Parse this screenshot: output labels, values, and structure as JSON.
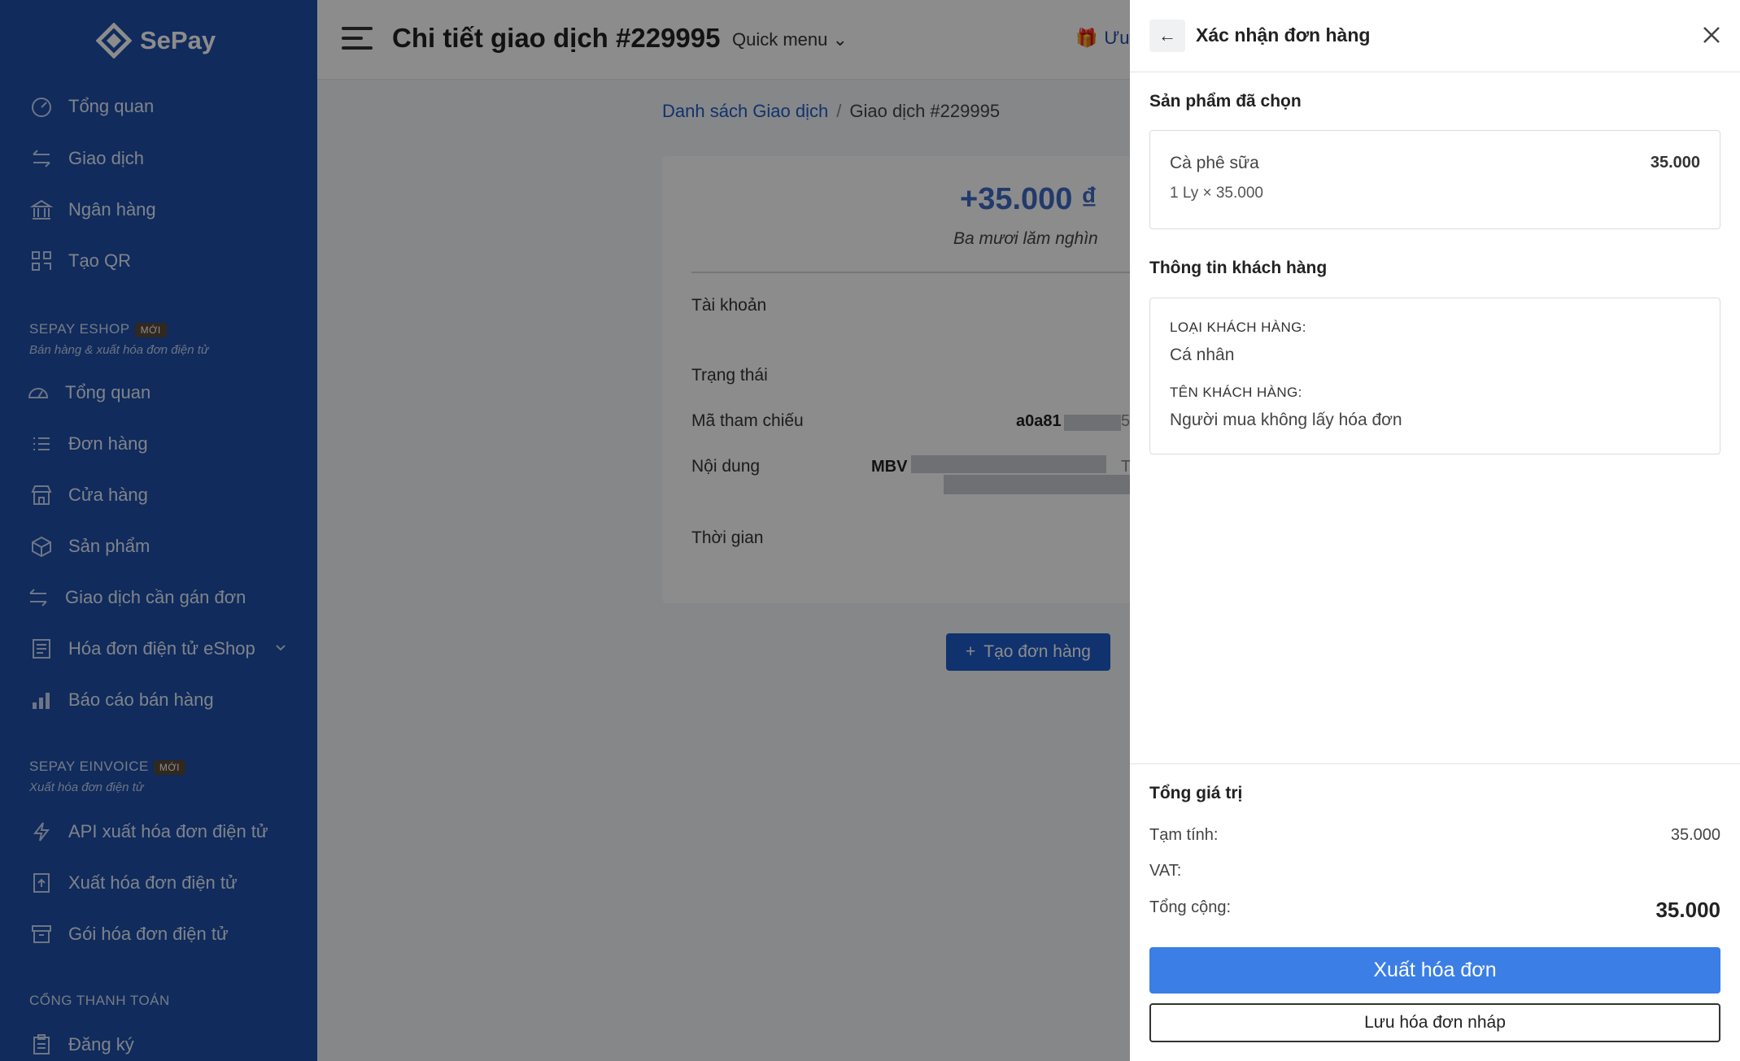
{
  "brand": {
    "name": "SePay"
  },
  "sidebar": {
    "main_items": [
      {
        "label": "Tổng quan",
        "icon": "dashboard-icon"
      },
      {
        "label": "Giao dịch",
        "icon": "transfer-icon"
      },
      {
        "label": "Ngân hàng",
        "icon": "bank-icon"
      },
      {
        "label": "Tạo QR",
        "icon": "qr-icon"
      }
    ],
    "eshop": {
      "title": "SEPAY ESHOP",
      "badge": "MỚI",
      "subtitle": "Bán hàng & xuất hóa đơn điện tử",
      "items": [
        {
          "label": "Tổng quan",
          "icon": "dashboard-icon"
        },
        {
          "label": "Đơn hàng",
          "icon": "list-icon"
        },
        {
          "label": "Cửa hàng",
          "icon": "store-icon"
        },
        {
          "label": "Sản phẩm",
          "icon": "box-icon"
        },
        {
          "label": "Giao dịch cần gán đơn",
          "icon": "transfer-icon"
        },
        {
          "label": "Hóa đơn điện tử eShop",
          "icon": "invoice-icon"
        },
        {
          "label": "Báo cáo bán hàng",
          "icon": "bar-chart-icon"
        }
      ]
    },
    "einvoice": {
      "title": "SEPAY EINVOICE",
      "badge": "MỚI",
      "subtitle": "Xuất hóa đơn điện tử",
      "items": [
        {
          "label": "API xuất hóa đơn điện tử",
          "icon": "bolt-icon"
        },
        {
          "label": "Xuất hóa đơn điện tử",
          "icon": "upload-file-icon"
        },
        {
          "label": "Gói hóa đơn điện tử",
          "icon": "archive-icon"
        }
      ]
    },
    "payment": {
      "title": "CỔNG THANH TOÁN",
      "items": [
        {
          "label": "Đăng ký",
          "icon": "clipboard-icon"
        }
      ]
    }
  },
  "header": {
    "title": "Chi tiết giao dịch #229995",
    "quick_menu": "Quick menu",
    "promo": "Ưu"
  },
  "breadcrumb": {
    "parent": "Danh sách Giao dịch",
    "separator": "/",
    "current": "Giao dịch #229995"
  },
  "transaction": {
    "amount": "+35.000 ₫",
    "amount_words": "Ba mươi lăm nghìn",
    "labels": {
      "account": "Tài khoản",
      "status": "Trạng thái",
      "reference": "Mã tham chiếu",
      "content": "Nội dung",
      "time": "Thời gian"
    },
    "reference_value": "a0a81",
    "reference_tail": "5",
    "content_value": "MBV",
    "content_tail": "T",
    "create_order_label": "Tạo đơn hàng"
  },
  "drawer": {
    "title": "Xác nhận đơn hàng",
    "selected_products_title": "Sản phẩm đã chọn",
    "product": {
      "name": "Cà phê sữa",
      "price": "35.000",
      "quantity_line": "1 Ly × 35.000"
    },
    "customer_title": "Thông tin khách hàng",
    "customer": {
      "type_label": "LOẠI KHÁCH HÀNG:",
      "type_value": "Cá nhân",
      "name_label": "TÊN KHÁCH HÀNG:",
      "name_value": "Người mua không lấy hóa đơn"
    },
    "summary": {
      "title": "Tổng giá trị",
      "subtotal_label": "Tạm tính:",
      "subtotal_value": "35.000",
      "vat_label": "VAT:",
      "vat_value": "",
      "total_label": "Tổng cộng:",
      "total_value": "35.000"
    },
    "primary_button": "Xuất hóa đơn",
    "secondary_button": "Lưu hóa đơn nháp"
  },
  "colors": {
    "sidebar_bg": "#1e4fa8",
    "primary": "#3b7ee6",
    "link": "#1e5cc8"
  }
}
